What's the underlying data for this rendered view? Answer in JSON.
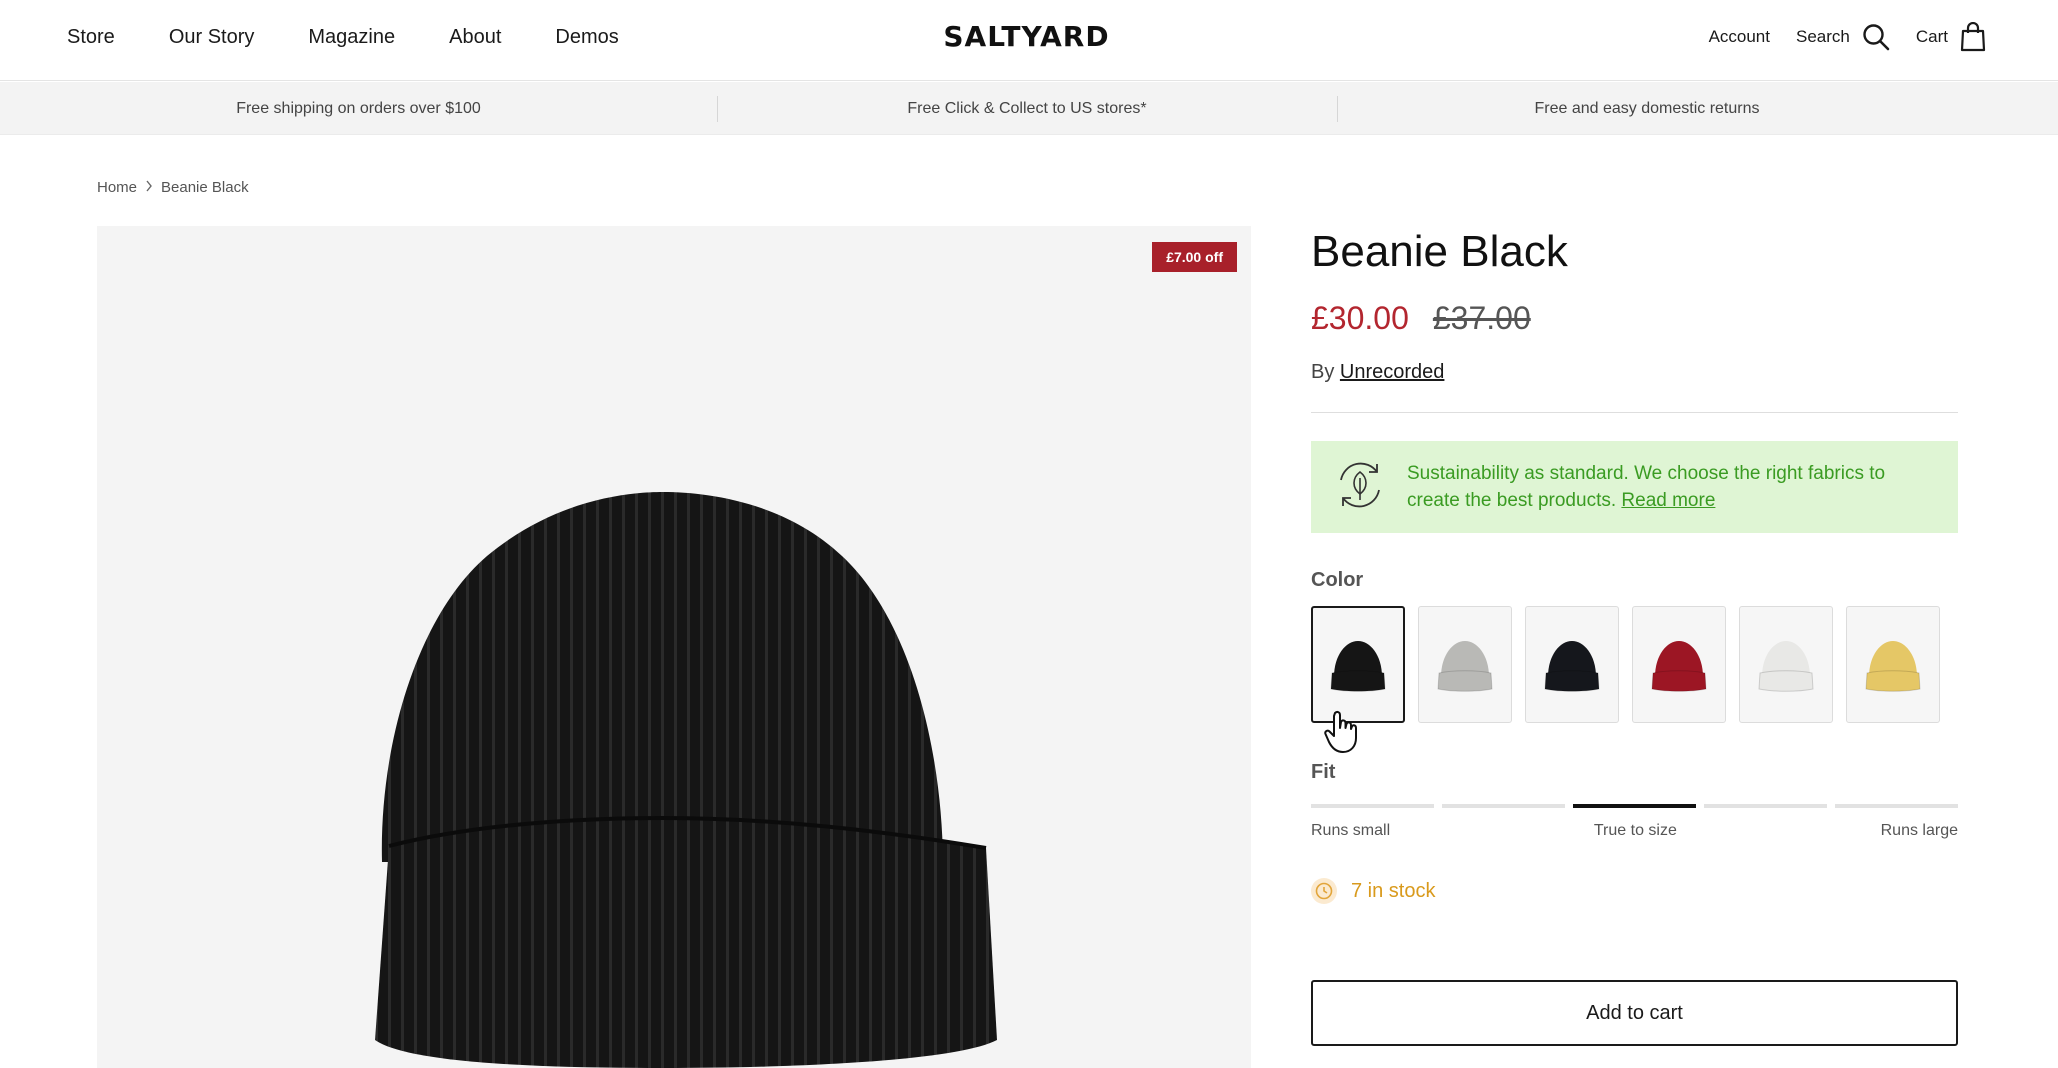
{
  "header": {
    "nav": [
      "Store",
      "Our Story",
      "Magazine",
      "About",
      "Demos"
    ],
    "logo": "SALTYARD",
    "account_label": "Account",
    "search_label": "Search",
    "cart_label": "Cart"
  },
  "announcements": [
    "Free shipping on orders over $100",
    "Free Click & Collect to US stores*",
    "Free and easy domestic returns"
  ],
  "breadcrumb": {
    "home": "Home",
    "current": "Beanie Black"
  },
  "product": {
    "badge": "£7.00 off",
    "title": "Beanie Black",
    "price": "£30.00",
    "compare_price": "£37.00",
    "vendor_prefix": "By",
    "vendor": "Unrecorded",
    "sustainability_text": "Sustainability as standard. We choose the right fabrics to create the best products.",
    "sustainability_link": "Read more",
    "color_label": "Color",
    "swatch_colors": [
      "#151515",
      "#b9b9b6",
      "#15171c",
      "#9c1624",
      "#e8e8e6",
      "#e5c766"
    ],
    "selected_swatch": 0,
    "fit_label": "Fit",
    "fit_scale": [
      "Runs small",
      "True to size",
      "Runs large"
    ],
    "fit_segments": 5,
    "fit_active_segment": 3,
    "stock_text": "7 in stock",
    "add_to_cart": "Add to cart"
  },
  "colors": {
    "sale_price": "#b3262f",
    "badge_bg": "#a8202a",
    "sustain_bg": "#dff5d4",
    "sustain_text": "#3a9b22",
    "stock": "#d99a1c"
  }
}
